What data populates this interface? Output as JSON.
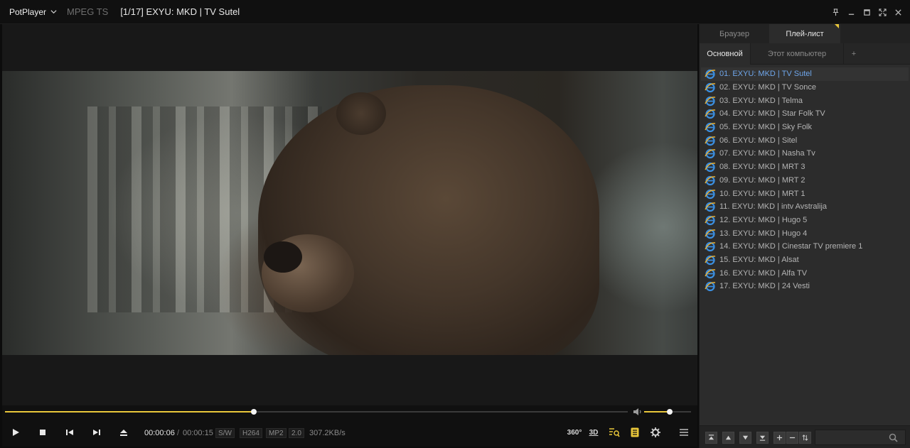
{
  "titlebar": {
    "app_name": "PotPlayer",
    "format": "MPEG TS",
    "title": "[1/17] EXYU: MKD | TV Sutel",
    "controls": [
      "pin-icon",
      "minimize-icon",
      "maximize-icon",
      "fullscreen-icon",
      "close-icon"
    ]
  },
  "player": {
    "seek_progress": 0.4,
    "volume_level": 0.55,
    "time_current": "00:00:06",
    "time_separator": "/",
    "time_total": "00:00:15",
    "badges": {
      "render": "S/W",
      "video_codec": "H264",
      "audio_codec": "MP2",
      "channels": "2.0"
    },
    "bitrate": "307.2KB/s",
    "right_controls": {
      "vr": "360°",
      "stereo": "3D"
    }
  },
  "sidebar": {
    "tabs": [
      "Браузер",
      "Плей-лист"
    ],
    "active_tab": 1,
    "subtabs": [
      "Основной",
      "Этот компьютер",
      "+"
    ],
    "active_subtab": 0,
    "playlist": [
      "01. EXYU: MKD | TV Sutel",
      "02. EXYU: MKD | TV Sonce",
      "03. EXYU: MKD | Telma",
      "04. EXYU: MKD | Star Folk TV",
      "05. EXYU: MKD | Sky Folk",
      "06. EXYU: MKD | Sitel",
      "07. EXYU: MKD | Nasha Tv",
      "08. EXYU: MKD | MRT 3",
      "09. EXYU: MKD | MRT 2",
      "10. EXYU: MKD | MRT 1",
      "11. EXYU: MKD | intv Avstralija",
      "12. EXYU: MKD | Hugo 5",
      "13. EXYU: MKD | Hugo 4",
      "14. EXYU: MKD | Cinestar TV premiere 1",
      "15. EXYU: MKD | Alsat",
      "16. EXYU: MKD | Alfa TV",
      "17. EXYU: MKD | 24 Vesti"
    ],
    "active_item": 0,
    "search_value": ""
  },
  "colors": {
    "accent": "#e9c73a",
    "active_item_text": "#6fa6ea",
    "background": "#101010",
    "sidebar_bg": "#2c2c2c"
  }
}
